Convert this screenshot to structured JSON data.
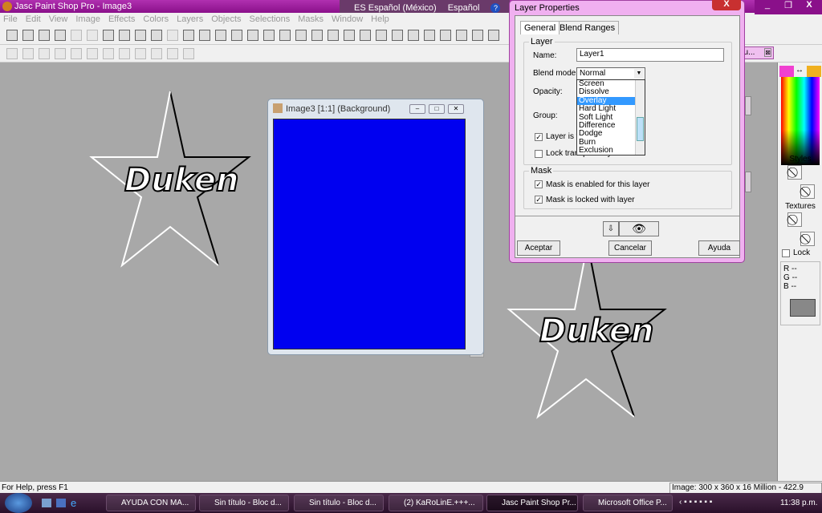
{
  "app": {
    "title": "Jasc Paint Shop Pro - Image3"
  },
  "language_bar": {
    "lang": "ES Español (México)",
    "keyboard": "Español",
    "help": "?"
  },
  "menu": [
    "File",
    "Edit",
    "View",
    "Image",
    "Effects",
    "Colors",
    "Layers",
    "Objects",
    "Selections",
    "Masks",
    "Window",
    "Help"
  ],
  "image_window": {
    "title": "Image3 [1:1] (Background)",
    "canvas_color": "#0000f0"
  },
  "canvas_text": [
    "Duken",
    "Duken"
  ],
  "docked_tab": {
    "label": "ou..."
  },
  "dialog": {
    "title": "Layer Properties",
    "close": "X",
    "tabs": [
      "General",
      "Blend Ranges"
    ],
    "layer_group": "Layer",
    "name_label": "Name:",
    "name_value": "Layer1",
    "blend_label": "Blend mode:",
    "blend_value": "Normal",
    "blend_options": [
      "Screen",
      "Dissolve",
      "Overlay",
      "Hard Light",
      "Soft Light",
      "Difference",
      "Dodge",
      "Burn",
      "Exclusion"
    ],
    "blend_highlighted": "Overlay",
    "opacity_label": "Opacity:",
    "group_label": "Group:",
    "visible_label": "Layer is visible",
    "visible_checked": true,
    "lock_label": "Lock transparency",
    "lock_checked": false,
    "mask_group": "Mask",
    "mask_enabled": "Mask is enabled for this layer",
    "mask_enabled_checked": true,
    "mask_locked": "Mask is locked with layer",
    "mask_locked_checked": true,
    "ok": "Aceptar",
    "cancel": "Cancelar",
    "help": "Ayuda"
  },
  "palette": {
    "fg_color": "#f040d0",
    "bg_color": "#f0b020",
    "styles": "Styles",
    "textures": "Textures",
    "lock": "Lock",
    "r": "R",
    "g": "G",
    "b": "B",
    "r_val": "--",
    "g_val": "--",
    "b_val": "--"
  },
  "status": {
    "help": "For Help, press F1",
    "image_info": "Image:  300 x 360 x 16 Million - 422.9 KBytes"
  },
  "taskbar": {
    "tasks": [
      "AYUDA CON MA...",
      "Sin título - Bloc d...",
      "Sin título - Bloc d...",
      "(2) KaRoLinE.+++...",
      "Jasc Paint Shop Pr...",
      "Microsoft Office P..."
    ],
    "active": "Jasc Paint Shop Pr...",
    "time": "11:38 p.m."
  }
}
